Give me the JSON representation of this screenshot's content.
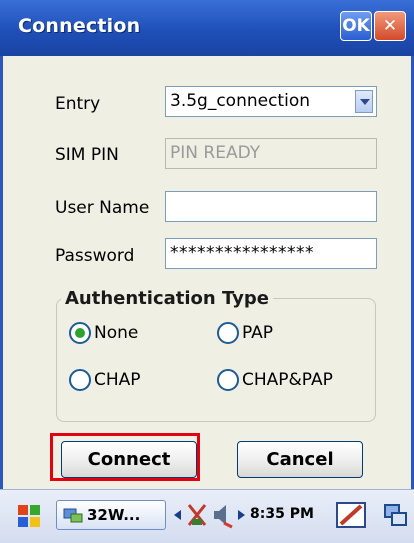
{
  "window": {
    "title": "Connection",
    "ok_label": "OK",
    "close_label": "✕"
  },
  "form": {
    "entry_label": "Entry",
    "entry_value": "3.5g_connection",
    "sim_pin_label": "SIM PIN",
    "sim_pin_value": "PIN READY",
    "user_name_label": "User Name",
    "user_name_value": "",
    "password_label": "Password",
    "password_value": "****************"
  },
  "auth": {
    "title": "Authentication Type",
    "options": [
      {
        "label": "None",
        "checked": true
      },
      {
        "label": "PAP",
        "checked": false
      },
      {
        "label": "CHAP",
        "checked": false
      },
      {
        "label": "CHAP&PAP",
        "checked": false
      }
    ]
  },
  "buttons": {
    "connect": "Connect",
    "cancel": "Cancel"
  },
  "taskbar": {
    "app_label": "32W...",
    "time": "8:35 PM",
    "icons": [
      "start-flag-icon",
      "network-app-icon",
      "scroll-left-icon",
      "signal-off-icon",
      "speaker-icon",
      "scroll-right-icon",
      "pen-input-icon",
      "desktop-icon"
    ]
  },
  "colors": {
    "titlebar": "#2456c4",
    "highlight": "#e3000f",
    "radio_selected": "#2fa12f"
  }
}
